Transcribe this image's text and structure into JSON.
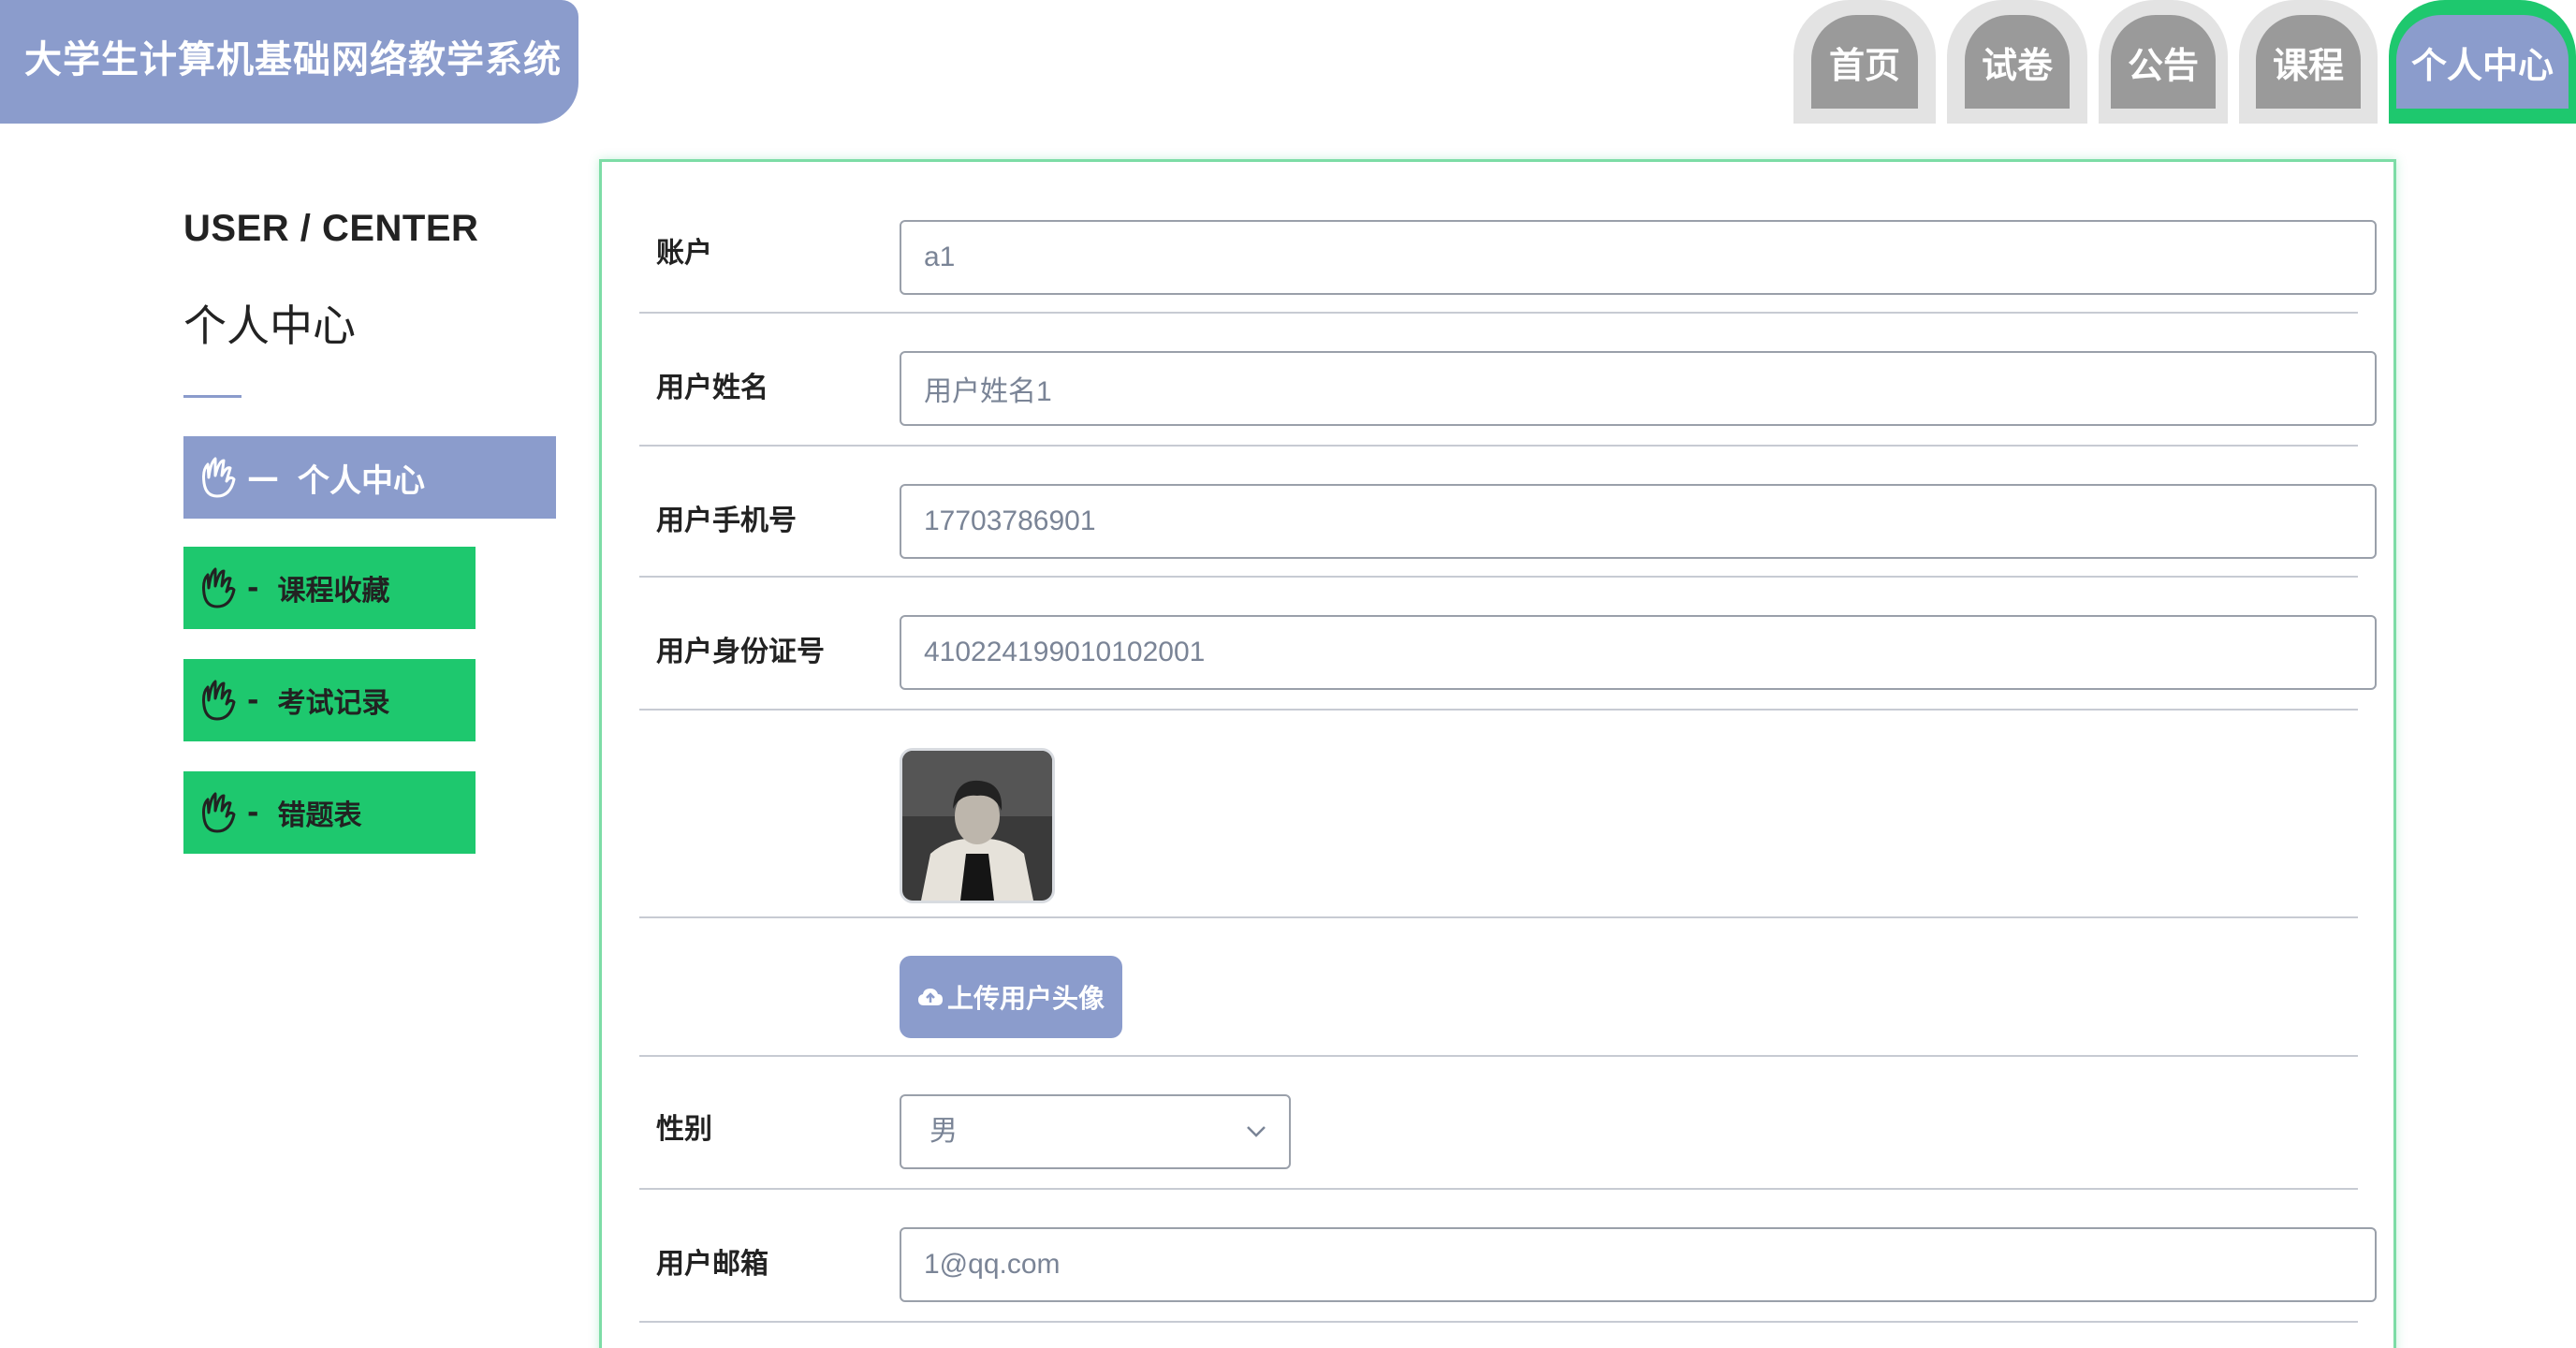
{
  "header": {
    "title": "大学生计算机基础网络教学系统"
  },
  "nav": {
    "tabs": [
      {
        "label": "首页",
        "active": false
      },
      {
        "label": "试卷",
        "active": false
      },
      {
        "label": "公告",
        "active": false
      },
      {
        "label": "课程",
        "active": false
      },
      {
        "label": "个人中心",
        "active": true
      }
    ]
  },
  "sidebar": {
    "title_en": "USER / CENTER",
    "title_cn": "个人中心",
    "items": [
      {
        "label": "个人中心",
        "icon": "hand-icon",
        "active": true
      },
      {
        "label": "课程收藏",
        "icon": "hand-icon",
        "active": false
      },
      {
        "label": "考试记录",
        "icon": "hand-icon",
        "active": false
      },
      {
        "label": "错题表",
        "icon": "hand-icon",
        "active": false
      }
    ],
    "dash_active": "—",
    "dash": "-"
  },
  "form": {
    "account": {
      "label": "账户",
      "value": "a1"
    },
    "name": {
      "label": "用户姓名",
      "value": "用户姓名1"
    },
    "phone": {
      "label": "用户手机号",
      "value": "17703786901"
    },
    "id_card": {
      "label": "用户身份证号",
      "value": "410224199010102001"
    },
    "upload": {
      "label": "上传用户头像"
    },
    "gender": {
      "label": "性别",
      "value": "男"
    },
    "email": {
      "label": "用户邮箱",
      "value": "1@qq.com"
    }
  },
  "colors": {
    "accent": "#8b9ccc",
    "green": "#1ec86e",
    "tab_gray": "#9a9a9a"
  }
}
